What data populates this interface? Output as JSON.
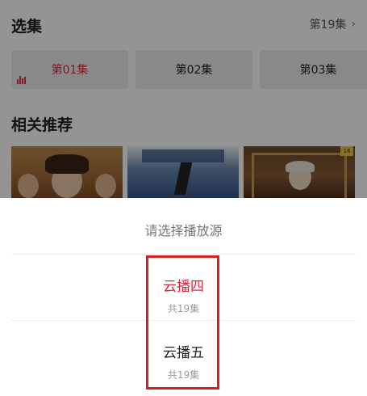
{
  "episodes": {
    "title": "选集",
    "count_label": "第19集",
    "items": [
      {
        "label": "第01集",
        "active": true
      },
      {
        "label": "第02集",
        "active": false
      },
      {
        "label": "第03集",
        "active": false
      }
    ]
  },
  "recommend": {
    "title": "相关推荐"
  },
  "sheet": {
    "title": "请选择播放源",
    "options": [
      {
        "name": "云播四",
        "sub": "共19集",
        "selected": true
      },
      {
        "name": "云播五",
        "sub": "共19集",
        "selected": false
      }
    ]
  },
  "colors": {
    "accent": "#e02e3e",
    "highlight_box": "#d62020"
  }
}
